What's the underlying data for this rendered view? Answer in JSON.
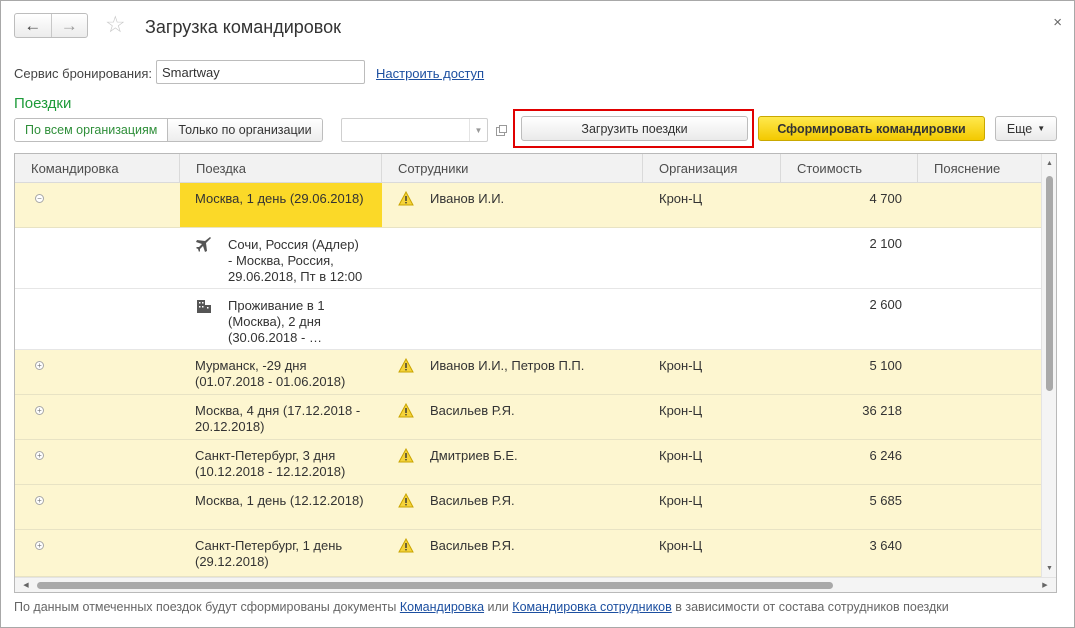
{
  "window": {
    "title": "Загрузка командировок",
    "back_icon": "←",
    "forward_icon": "→",
    "favorite_icon": "☆",
    "close_icon": "×"
  },
  "booking": {
    "label": "Сервис бронирования:",
    "value": "Smartway",
    "access_link": "Настроить доступ"
  },
  "section": {
    "title": "Поездки"
  },
  "toolbar": {
    "filter_all": "По всем организациям",
    "filter_one": "Только по организации",
    "organization_value": "",
    "load_button": "Загрузить поездки",
    "create_button": "Сформировать командировки",
    "more_button": "Еще"
  },
  "table": {
    "columns": [
      "Командировка",
      "Поездка",
      "Сотрудники",
      "Организация",
      "Стоимость",
      "Пояснение"
    ],
    "rows": [
      {
        "trip": "Москва, 1 день (29.06.2018)",
        "employees": "Иванов И.И.",
        "organization": "Крон-Ц",
        "cost": "4 700",
        "note": ""
      },
      {
        "trip": "Мурманск, -29 дня\n(01.07.2018 - 01.06.2018)",
        "employees": "Иванов И.И., Петров П.П.",
        "organization": "Крон-Ц",
        "cost": "5 100",
        "note": ""
      },
      {
        "trip": "Москва, 4 дня (17.12.2018 -\n20.12.2018)",
        "employees": "Васильев Р.Я.",
        "organization": "Крон-Ц",
        "cost": "36 218",
        "note": ""
      },
      {
        "trip": "Санкт-Петербург, 3 дня\n(10.12.2018 - 12.12.2018)",
        "employees": "Дмитриев Б.Е.",
        "organization": "Крон-Ц",
        "cost": "6 246",
        "note": ""
      },
      {
        "trip": "Москва, 1 день (12.12.2018)",
        "employees": "Васильев Р.Я.",
        "organization": "Крон-Ц",
        "cost": "5 685",
        "note": ""
      },
      {
        "trip": "Санкт-Петербург, 1 день\n(29.12.2018)",
        "employees": "Васильев Р.Я.",
        "organization": "Крон-Ц",
        "cost": "3 640",
        "note": ""
      }
    ],
    "children": [
      {
        "icon": "airplane-icon",
        "text": "Сочи, Россия (Адлер)\n- Москва, Россия,\n29.06.2018, Пт в 12:00",
        "cost": "2 100"
      },
      {
        "icon": "hotel-icon",
        "text": "Проживание в 1\n(Москва), 2 дня\n(30.06.2018 - …",
        "cost": "2 600"
      }
    ]
  },
  "footer": {
    "text_before": "По данным отмеченных поездок будут сформированы документы ",
    "link1": "Командировка",
    "text_middle": " или ",
    "link2": "Командировка сотрудников",
    "text_after": " в зависимости от состава сотрудников поездки"
  }
}
